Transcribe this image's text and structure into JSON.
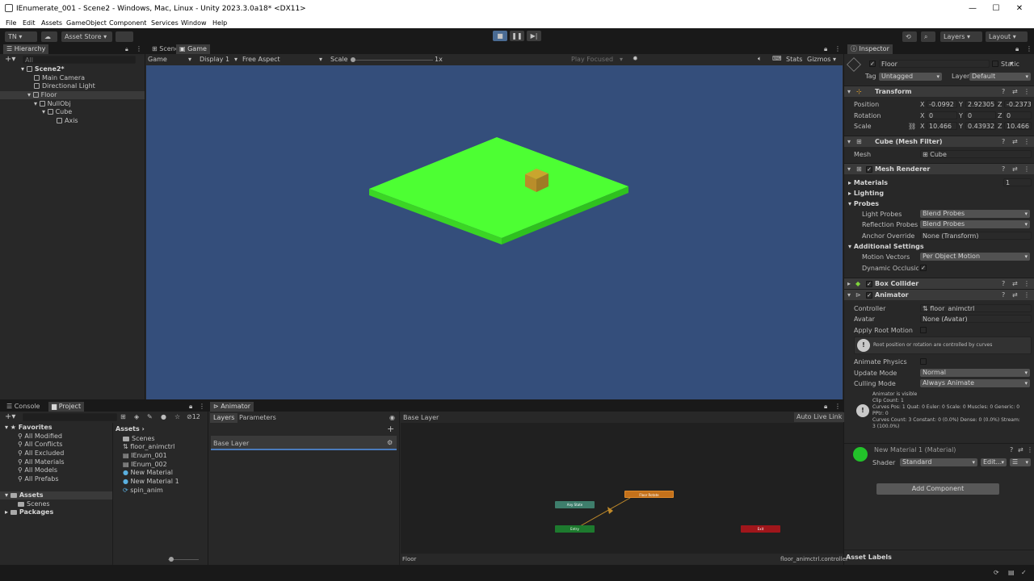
{
  "window": {
    "title": "IEnumerate_001 - Scene2 - Windows, Mac, Linux - Unity 2023.3.0a18* <DX11>"
  },
  "menu": [
    "File",
    "Edit",
    "Assets",
    "GameObject",
    "Component",
    "Services",
    "Window",
    "Help"
  ],
  "toolbar": {
    "account": "TN",
    "asset_store": "Asset Store",
    "layers": "Layers",
    "layout": "Layout"
  },
  "hierarchy": {
    "tab": "Hierarchy",
    "search_placeholder": "All",
    "items": [
      "Scene2*",
      "Main Camera",
      "Directional Light",
      "Floor",
      "NullObj",
      "Cube",
      "Axis"
    ]
  },
  "game_view": {
    "tabs": [
      "Scene",
      "Game"
    ],
    "mode": "Game",
    "display": "Display 1",
    "aspect": "Free Aspect",
    "scale_label": "Scale",
    "scale_value": "1x",
    "play_focused": "Play Focused",
    "stats": "Stats",
    "gizmos": "Gizmos",
    "colors": {
      "background": "#344e7b",
      "floor": "#4dff33",
      "cube": "#c9a52e"
    }
  },
  "inspector": {
    "tab": "Inspector",
    "object_name": "Floor",
    "static_label": "Static",
    "tag_label": "Tag",
    "tag_value": "Untagged",
    "layer_label": "Layer",
    "layer_value": "Default",
    "transform": {
      "title": "Transform",
      "position_label": "Position",
      "position": [
        "-0.0992",
        "2.92305",
        "-0.2373"
      ],
      "rotation_label": "Rotation",
      "rotation": [
        "0",
        "0",
        "0"
      ],
      "scale_label": "Scale",
      "scale": [
        "10.466",
        "0.43932",
        "10.466"
      ]
    },
    "mesh_filter": {
      "title": "Cube (Mesh Filter)",
      "mesh_label": "Mesh",
      "mesh_value": "Cube"
    },
    "mesh_renderer": {
      "title": "Mesh Renderer",
      "materials_label": "Materials",
      "materials_count": "1",
      "lighting_label": "Lighting",
      "probes_label": "Probes",
      "light_probes_label": "Light Probes",
      "light_probes_value": "Blend Probes",
      "reflection_probes_label": "Reflection Probes",
      "reflection_probes_value": "Blend Probes",
      "anchor_override_label": "Anchor Override",
      "anchor_override_value": "None (Transform)",
      "additional_settings_label": "Additional Settings",
      "motion_vectors_label": "Motion Vectors",
      "motion_vectors_value": "Per Object Motion",
      "dynamic_occlusion_label": "Dynamic Occlusion"
    },
    "box_collider": {
      "title": "Box Collider"
    },
    "animator": {
      "title": "Animator",
      "controller_label": "Controller",
      "controller_value": "floor_animctrl",
      "avatar_label": "Avatar",
      "avatar_value": "None (Avatar)",
      "apply_root_motion_label": "Apply Root Motion",
      "root_info": "Root position or rotation are controlled by curves",
      "animate_physics_label": "Animate Physics",
      "update_mode_label": "Update Mode",
      "update_mode_value": "Normal",
      "culling_mode_label": "Culling Mode",
      "culling_mode_value": "Always Animate",
      "info_lines": [
        "Animator is visible",
        "Clip Count: 1",
        "Curves Pos: 1 Quat: 0 Euler: 0 Scale: 0 Muscles: 0 Generic: 0",
        "PPtr: 0",
        "Curves Count: 3 Constant: 0 (0.0%) Dense: 0 (0.0%) Stream:",
        "3 (100.0%)"
      ]
    },
    "material": {
      "title": "New Material 1 (Material)",
      "shader_label": "Shader",
      "shader_value": "Standard",
      "edit_label": "Edit...",
      "color": "#22c22a"
    },
    "add_component": "Add Component",
    "asset_labels": "Asset Labels"
  },
  "project": {
    "tabs": [
      "Console",
      "Project"
    ],
    "count": "12",
    "favorites_label": "Favorites",
    "favorites": [
      "All Modified",
      "All Conflicts",
      "All Excluded",
      "All Materials",
      "All Models",
      "All Prefabs"
    ],
    "assets_label": "Assets",
    "tree_assets": [
      "Scenes"
    ],
    "packages_label": "Packages",
    "breadcrumb": "Assets",
    "files": [
      "Scenes",
      "floor_animctrl",
      "IEnum_001",
      "IEnum_002",
      "New Material",
      "New Material 1",
      "spin_anim"
    ]
  },
  "animator_window": {
    "tab": "Animator",
    "subtabs": [
      "Layers",
      "Parameters"
    ],
    "layer_breadcrumb": "Base Layer",
    "auto_live_link": "Auto Live Link",
    "layers": [
      "Base Layer"
    ],
    "nodes": {
      "any_state": "Any State",
      "floor_state": "Floor Rotate",
      "entry": "Entry",
      "exit": "Exit"
    },
    "footer_left": "Floor",
    "footer_right": "floor_animctrl.controller"
  }
}
